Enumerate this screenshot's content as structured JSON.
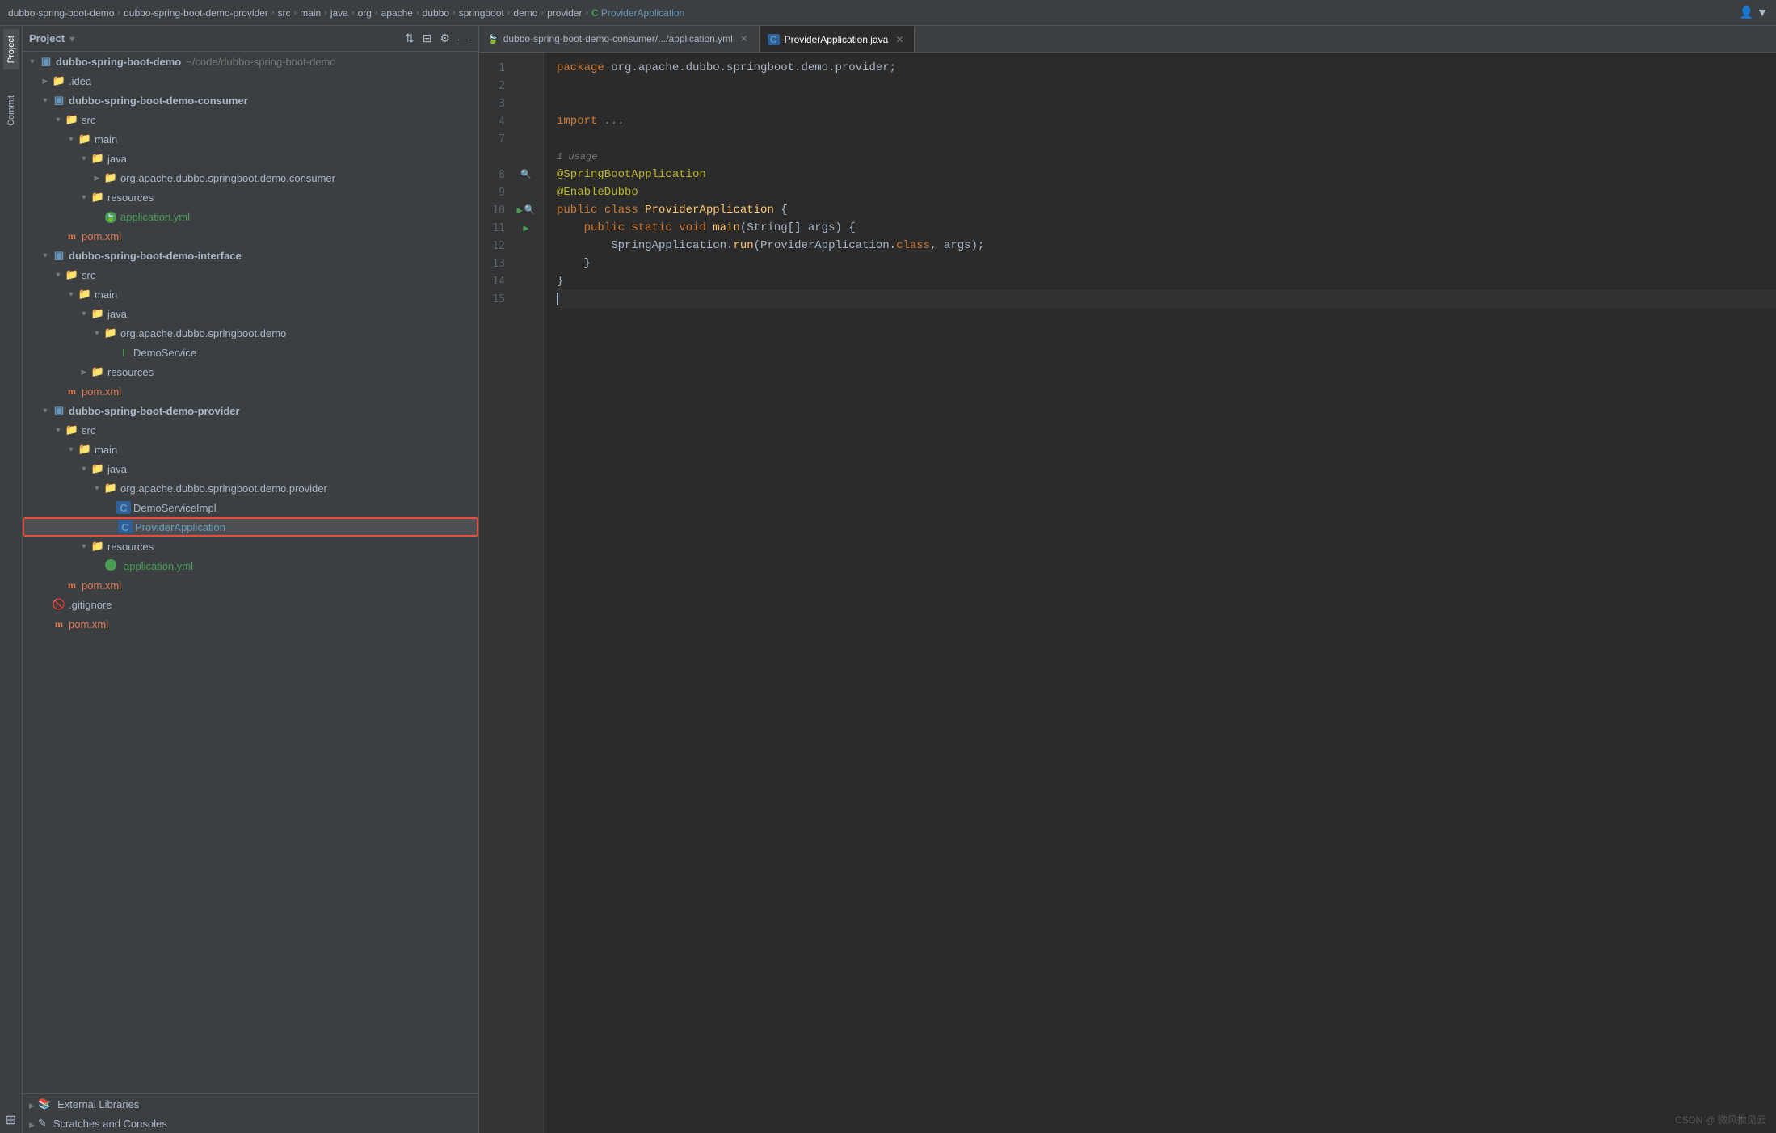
{
  "breadcrumb": {
    "items": [
      {
        "label": "dubbo-spring-boot-demo",
        "type": "root"
      },
      {
        "label": "dubbo-spring-boot-demo-provider",
        "type": "module"
      },
      {
        "label": "src",
        "type": "folder"
      },
      {
        "label": "main",
        "type": "folder"
      },
      {
        "label": "java",
        "type": "folder"
      },
      {
        "label": "org",
        "type": "package"
      },
      {
        "label": "apache",
        "type": "package"
      },
      {
        "label": "dubbo",
        "type": "package"
      },
      {
        "label": "springboot",
        "type": "package"
      },
      {
        "label": "demo",
        "type": "package"
      },
      {
        "label": "provider",
        "type": "package"
      },
      {
        "label": "ProviderApplication",
        "type": "class"
      }
    ],
    "separator": "›"
  },
  "sidebar": {
    "title": "Project",
    "dropdown_arrow": "▼",
    "actions": {
      "settings_label": "⚙",
      "minimize_label": "—",
      "equalizer_label": "⇅",
      "layout_label": "⊟"
    },
    "tree": [
      {
        "id": "root",
        "level": 0,
        "expanded": true,
        "label": "dubbo-spring-boot-demo",
        "sublabel": "~/code/dubbo-spring-boot-demo",
        "icon": "module",
        "bold": true
      },
      {
        "id": "idea",
        "level": 1,
        "expanded": false,
        "label": ".idea",
        "icon": "folder"
      },
      {
        "id": "consumer-module",
        "level": 1,
        "expanded": true,
        "label": "dubbo-spring-boot-demo-consumer",
        "icon": "module",
        "bold": true
      },
      {
        "id": "consumer-src",
        "level": 2,
        "expanded": true,
        "label": "src",
        "icon": "folder"
      },
      {
        "id": "consumer-main",
        "level": 3,
        "expanded": true,
        "label": "main",
        "icon": "folder"
      },
      {
        "id": "consumer-java",
        "level": 4,
        "expanded": true,
        "label": "java",
        "icon": "folder"
      },
      {
        "id": "consumer-pkg",
        "level": 5,
        "expanded": false,
        "label": "org.apache.dubbo.springboot.demo.consumer",
        "icon": "package"
      },
      {
        "id": "consumer-resources",
        "level": 4,
        "expanded": true,
        "label": "resources",
        "icon": "folder"
      },
      {
        "id": "consumer-yml",
        "level": 5,
        "expanded": false,
        "label": "application.yml",
        "icon": "yml"
      },
      {
        "id": "consumer-pom",
        "level": 2,
        "expanded": false,
        "label": "pom.xml",
        "icon": "xml"
      },
      {
        "id": "interface-module",
        "level": 1,
        "expanded": true,
        "label": "dubbo-spring-boot-demo-interface",
        "icon": "module",
        "bold": true
      },
      {
        "id": "interface-src",
        "level": 2,
        "expanded": true,
        "label": "src",
        "icon": "folder"
      },
      {
        "id": "interface-main",
        "level": 3,
        "expanded": true,
        "label": "main",
        "icon": "folder"
      },
      {
        "id": "interface-java",
        "level": 4,
        "expanded": true,
        "label": "java",
        "icon": "folder"
      },
      {
        "id": "interface-pkg",
        "level": 5,
        "expanded": true,
        "label": "org.apache.dubbo.springboot.demo",
        "icon": "package"
      },
      {
        "id": "demoservice",
        "level": 6,
        "expanded": false,
        "label": "DemoService",
        "icon": "interface"
      },
      {
        "id": "interface-resources",
        "level": 4,
        "expanded": false,
        "label": "resources",
        "icon": "folder"
      },
      {
        "id": "interface-pom",
        "level": 2,
        "expanded": false,
        "label": "pom.xml",
        "icon": "xml"
      },
      {
        "id": "provider-module",
        "level": 1,
        "expanded": true,
        "label": "dubbo-spring-boot-demo-provider",
        "icon": "module",
        "bold": true
      },
      {
        "id": "provider-src",
        "level": 2,
        "expanded": true,
        "label": "src",
        "icon": "folder"
      },
      {
        "id": "provider-main",
        "level": 3,
        "expanded": true,
        "label": "main",
        "icon": "folder"
      },
      {
        "id": "provider-java",
        "level": 4,
        "expanded": true,
        "label": "java",
        "icon": "folder"
      },
      {
        "id": "provider-pkg",
        "level": 5,
        "expanded": true,
        "label": "org.apache.dubbo.springboot.demo.provider",
        "icon": "package"
      },
      {
        "id": "demoimpl",
        "level": 6,
        "expanded": false,
        "label": "DemoServiceImpl",
        "icon": "class-green"
      },
      {
        "id": "providerapplication",
        "level": 6,
        "expanded": false,
        "label": "ProviderApplication",
        "icon": "class-green",
        "selected": true
      },
      {
        "id": "provider-resources",
        "level": 4,
        "expanded": true,
        "label": "resources",
        "icon": "folder"
      },
      {
        "id": "provider-yml",
        "level": 5,
        "expanded": false,
        "label": "application.yml",
        "icon": "yml"
      },
      {
        "id": "provider-pom",
        "level": 2,
        "expanded": false,
        "label": "pom.xml",
        "icon": "xml"
      },
      {
        "id": "gitignore",
        "level": 1,
        "expanded": false,
        "label": ".gitignore",
        "icon": "git"
      },
      {
        "id": "root-pom",
        "level": 1,
        "expanded": false,
        "label": "pom.xml",
        "icon": "xml"
      }
    ],
    "footer": [
      {
        "id": "ext-libs",
        "label": "External Libraries",
        "icon": "ext-lib",
        "expanded": false
      },
      {
        "id": "scratches",
        "label": "Scratches and Consoles",
        "icon": "scratch",
        "expanded": false
      }
    ]
  },
  "left_tabs": [
    {
      "id": "project",
      "label": "Project",
      "active": true
    },
    {
      "id": "commit",
      "label": "Commit",
      "active": false
    }
  ],
  "editor": {
    "tabs": [
      {
        "id": "appyml",
        "label": "dubbo-spring-boot-demo-consumer/.../application.yml",
        "icon": "yml",
        "active": false,
        "closeable": true
      },
      {
        "id": "providerapplication",
        "label": "ProviderApplication.java",
        "icon": "class",
        "active": true,
        "closeable": true
      }
    ],
    "lines": [
      {
        "num": 1,
        "tokens": [
          {
            "text": "package ",
            "class": "kw"
          },
          {
            "text": "org.apache.dubbo.springboot.demo.provider",
            "class": "package"
          },
          {
            "text": ";",
            "class": "type"
          }
        ],
        "gutter": ""
      },
      {
        "num": 2,
        "tokens": [],
        "gutter": ""
      },
      {
        "num": 3,
        "tokens": [],
        "gutter": ""
      },
      {
        "num": 4,
        "tokens": [
          {
            "text": "import ",
            "class": "kw"
          },
          {
            "text": "...",
            "class": "comment"
          }
        ],
        "gutter": ""
      },
      {
        "num": 7,
        "tokens": [],
        "gutter": ""
      },
      {
        "num": "",
        "tokens": [
          {
            "text": "1 usage",
            "class": "usage-hint"
          }
        ],
        "gutter": ""
      },
      {
        "num": 8,
        "tokens": [
          {
            "text": "@SpringBootApplication",
            "class": "annotation"
          }
        ],
        "gutter": "usage"
      },
      {
        "num": 9,
        "tokens": [
          {
            "text": "@EnableDubbo",
            "class": "annotation"
          }
        ],
        "gutter": ""
      },
      {
        "num": 10,
        "tokens": [
          {
            "text": "public ",
            "class": "kw"
          },
          {
            "text": "class ",
            "class": "kw"
          },
          {
            "text": "ProviderApplication",
            "class": "class-name"
          },
          {
            "text": " {",
            "class": "type"
          }
        ],
        "gutter": "run"
      },
      {
        "num": 11,
        "tokens": [
          {
            "text": "    public ",
            "class": "kw"
          },
          {
            "text": "static ",
            "class": "kw"
          },
          {
            "text": "void ",
            "class": "kw"
          },
          {
            "text": "main",
            "class": "method"
          },
          {
            "text": "(String[] args) {",
            "class": "type"
          }
        ],
        "gutter": "run"
      },
      {
        "num": 12,
        "tokens": [
          {
            "text": "        SpringApplication.",
            "class": "type"
          },
          {
            "text": "run",
            "class": "method"
          },
          {
            "text": "(ProviderApplication.",
            "class": "type"
          },
          {
            "text": "class",
            "class": "kw"
          },
          {
            "text": ", args);",
            "class": "type"
          }
        ],
        "gutter": ""
      },
      {
        "num": 13,
        "tokens": [
          {
            "text": "    }",
            "class": "type"
          }
        ],
        "gutter": ""
      },
      {
        "num": 14,
        "tokens": [
          {
            "text": "}",
            "class": "type"
          }
        ],
        "gutter": ""
      },
      {
        "num": 15,
        "tokens": [],
        "gutter": "",
        "cursor": true
      }
    ]
  },
  "watermark": "CSDN @ 微风推见云"
}
